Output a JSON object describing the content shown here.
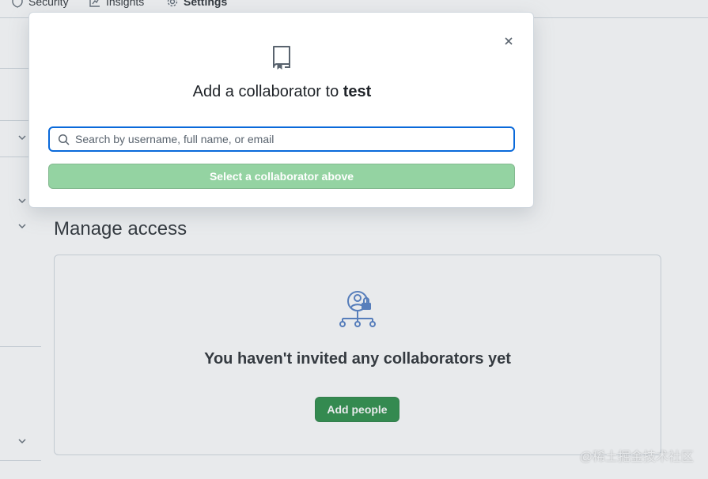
{
  "topnav": {
    "items": [
      {
        "label": "Security",
        "icon": "shield-icon"
      },
      {
        "label": "Insights",
        "icon": "graph-icon"
      },
      {
        "label": "Settings",
        "icon": "gear-icon",
        "active": true
      }
    ]
  },
  "manage_access": {
    "title": "Manage access",
    "empty_message": "You haven't invited any collaborators yet",
    "add_people_label": "Add people"
  },
  "modal": {
    "title_prefix": "Add a collaborator to",
    "repo_name": "test",
    "search_placeholder": "Search by username, full name, or email",
    "select_button_label": "Select a collaborator above",
    "close_label": "×"
  },
  "watermark": "@稀土掘金技术社区",
  "colors": {
    "primary_green": "#1f883d",
    "disabled_green": "#94d3a2",
    "focus_blue": "#0969da",
    "border": "#d0d7de",
    "icon_blue": "#4a78c2"
  }
}
